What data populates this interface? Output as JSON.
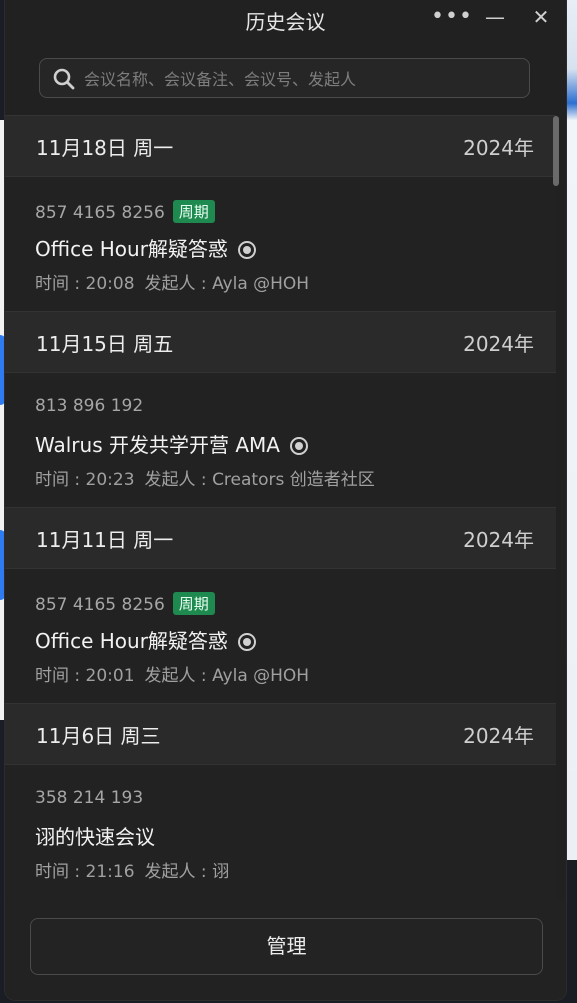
{
  "window": {
    "title": "历史会议",
    "more_label": "•••",
    "minimize_label": "—",
    "close_label": "✕"
  },
  "search": {
    "placeholder": "会议名称、会议备注、会议号、发起人",
    "value": ""
  },
  "groups": [
    {
      "date": "11月18日 周一",
      "year": "2024年",
      "meeting": {
        "id": "857 4165 8256",
        "badge": "周期",
        "title": "Office Hour解疑答惑",
        "has_record_icon": true,
        "time": "时间 : 20:08",
        "host": "发起人 : Ayla @HOH"
      }
    },
    {
      "date": "11月15日 周五",
      "year": "2024年",
      "meeting": {
        "id": "813 896 192",
        "badge": "",
        "title": "Walrus 开发共学开营 AMA",
        "has_record_icon": true,
        "time": "时间 : 20:23",
        "host": "发起人 : Creators 创造者社区"
      }
    },
    {
      "date": "11月11日 周一",
      "year": "2024年",
      "meeting": {
        "id": "857 4165 8256",
        "badge": "周期",
        "title": "Office Hour解疑答惑",
        "has_record_icon": true,
        "time": "时间 : 20:01",
        "host": "发起人 : Ayla @HOH"
      }
    },
    {
      "date": "11月6日 周三",
      "year": "2024年",
      "meeting": {
        "id": "358 214 193",
        "badge": "",
        "title": "诩的快速会议",
        "has_record_icon": false,
        "time": "时间 : 21:16",
        "host": "发起人 : 诩"
      }
    }
  ],
  "footer": {
    "manage_label": "管理"
  },
  "colors": {
    "badge_green": "#1e8a4f",
    "panel_bg": "#212121",
    "header_bg": "#2a2a2a"
  }
}
